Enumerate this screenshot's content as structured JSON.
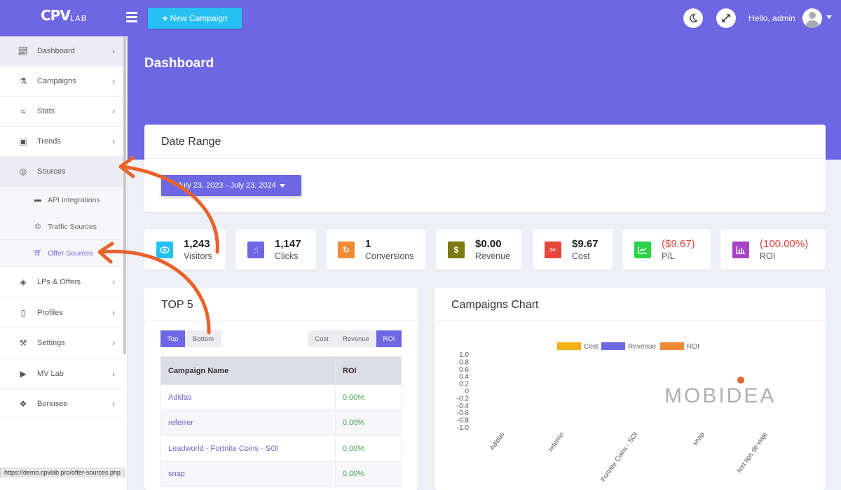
{
  "app": {
    "logo_main": "CPV",
    "logo_sub": "LAB"
  },
  "topbar": {
    "new_campaign_label": "New Campaign",
    "new_campaign_icon": "plus-icon",
    "greeting": "Hello, admin",
    "dark_mode_icon": "moon-icon",
    "fullscreen_icon": "expand-icon",
    "avatar_icon": "user-icon"
  },
  "colors": {
    "brand": "#6d67e4",
    "accent": "#27c0f3",
    "negative": "#e0443a",
    "positive": "#3aa34a",
    "annotation": "#e8622c"
  },
  "sidebar": {
    "items": [
      {
        "label": "Dashboard",
        "icon": "line-chart-icon"
      },
      {
        "label": "Campaigns",
        "icon": "flask-icon"
      },
      {
        "label": "Stats",
        "icon": "trend-icon"
      },
      {
        "label": "Trends",
        "icon": "briefcase-icon"
      },
      {
        "label": "Sources",
        "icon": "globe-icon"
      },
      {
        "label": "LPs & Offers",
        "icon": "tag-icon"
      },
      {
        "label": "Profiles",
        "icon": "clipboard-icon"
      },
      {
        "label": "Settings",
        "icon": "wrench-icon"
      },
      {
        "label": "MV Lab",
        "icon": "play-circle-icon"
      },
      {
        "label": "Bonuses",
        "icon": "gift-icon"
      }
    ],
    "subitems": [
      {
        "label": "API Integrations",
        "icon": "folder-icon"
      },
      {
        "label": "Traffic Sources",
        "icon": "globe-icon"
      },
      {
        "label": "Offer Sources",
        "icon": "cart-icon"
      }
    ]
  },
  "page": {
    "title": "Dashboard"
  },
  "date_range": {
    "title": "Date Range",
    "value": "July 23, 2023 - July 23, 2024"
  },
  "stats": [
    {
      "value": "1,243",
      "label": "Visitors",
      "icon": "eye-icon",
      "color": "#27c0f3"
    },
    {
      "value": "1,147",
      "label": "Clicks",
      "icon": "pointer-icon",
      "color": "#6d67e4"
    },
    {
      "value": "1",
      "label": "Conversions",
      "icon": "refresh-icon",
      "color": "#f08a35"
    },
    {
      "value": "$0.00",
      "label": "Revenue",
      "icon": "dollar-icon",
      "color": "#7a7a10"
    },
    {
      "value": "$9.67",
      "label": "Cost",
      "icon": "scissors-icon",
      "color": "#e8453c"
    },
    {
      "value": "($9.67)",
      "label": "P/L",
      "icon": "area-chart-icon",
      "color": "#2bd24a"
    },
    {
      "value": "(100.00%)",
      "label": "ROI",
      "icon": "bar-chart-icon",
      "color": "#a844c8"
    }
  ],
  "top5": {
    "title": "TOP 5",
    "toggle": [
      "Top",
      "Bottom"
    ],
    "metrics": [
      "Cost",
      "Revenue",
      "ROI"
    ],
    "columns": [
      "Campaign Name",
      "ROI"
    ],
    "rows": [
      {
        "name": "Adidas",
        "roi": "0.00%"
      },
      {
        "name": "referrer",
        "roi": "0.00%"
      },
      {
        "name": "Leadworld - Fortnite Coins - SOI",
        "roi": "0.00%"
      },
      {
        "name": "snap",
        "roi": "0.00%"
      }
    ]
  },
  "chart_data": {
    "type": "bar",
    "title": "Campaigns Chart",
    "categories": [
      "Adidas",
      "referrer",
      "Fortnite Coins - SOI",
      "snap",
      "test tips de viaje"
    ],
    "series": [
      {
        "name": "Cost",
        "color": "#f5b01a",
        "values": [
          0,
          0,
          0,
          0,
          0
        ]
      },
      {
        "name": "Revenue",
        "color": "#6d67e4",
        "values": [
          0,
          0,
          0,
          0,
          0
        ]
      },
      {
        "name": "ROI",
        "color": "#f08a35",
        "values": [
          0,
          0,
          0,
          0,
          0
        ]
      }
    ],
    "yticks": [
      "1.0",
      "0.8",
      "0.6",
      "0.4",
      "0.2",
      "0",
      "-0.2",
      "-0.4",
      "-0.6",
      "-0.8",
      "-1.0"
    ],
    "ylim": [
      -1.0,
      1.0
    ],
    "legend_position": "top",
    "watermark": "MOBIDEA"
  },
  "status_bar": {
    "url": "https://demo.cpvlab.pro/offer-sources.php"
  }
}
